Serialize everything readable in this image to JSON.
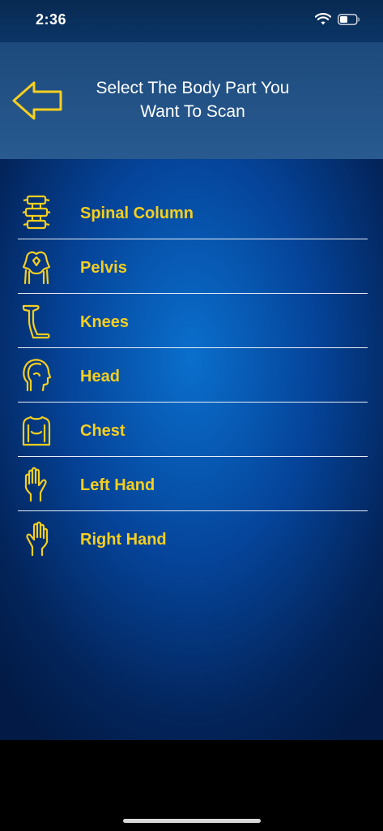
{
  "status_bar": {
    "time": "2:36"
  },
  "header": {
    "title_line1": "Select The Body Part You",
    "title_line2": "Want To Scan",
    "back_icon": "arrow-left-icon"
  },
  "body_parts": [
    {
      "label": "Spinal Column",
      "icon": "spine-icon"
    },
    {
      "label": "Pelvis",
      "icon": "pelvis-icon"
    },
    {
      "label": "Knees",
      "icon": "knee-icon"
    },
    {
      "label": "Head",
      "icon": "head-icon"
    },
    {
      "label": "Chest",
      "icon": "chest-icon"
    },
    {
      "label": "Left Hand",
      "icon": "left-hand-icon"
    },
    {
      "label": "Right Hand",
      "icon": "right-hand-icon"
    }
  ],
  "colors": {
    "accent_yellow": "#f6cf1f",
    "background_blue": "#05449a",
    "header_blue": "#285a90"
  }
}
